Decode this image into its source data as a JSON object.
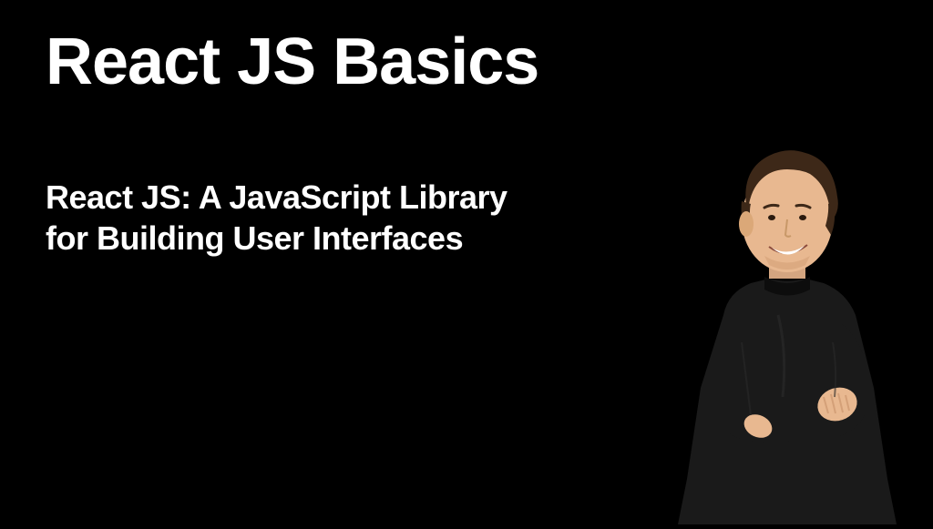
{
  "slide": {
    "title": "React JS Basics",
    "subtitle": "React JS: A JavaScript Library for Building User Interfaces"
  },
  "colors": {
    "background": "#000000",
    "text": "#ffffff"
  }
}
